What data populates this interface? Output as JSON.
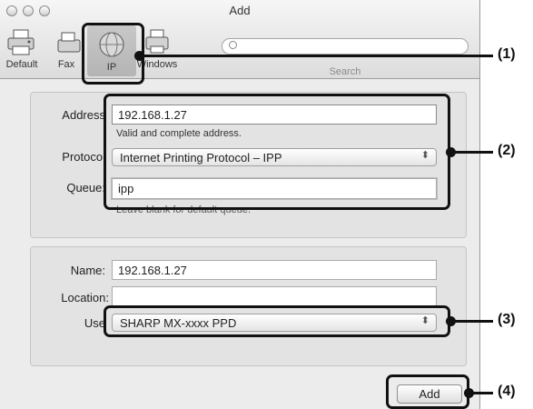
{
  "window": {
    "title": "Add"
  },
  "toolbar": {
    "items": [
      {
        "label": "Default",
        "icon": "printer-icon"
      },
      {
        "label": "Fax",
        "icon": "fax-icon"
      },
      {
        "label": "IP",
        "icon": "globe-icon"
      },
      {
        "label": "Windows",
        "icon": "windows-printer-icon"
      }
    ],
    "search_label": "Search"
  },
  "connection": {
    "address_label": "Address",
    "address_value": "192.168.1.27",
    "address_status": "Valid and complete address.",
    "protocol_label": "Protocol",
    "protocol_value": "Internet Printing Protocol – IPP",
    "queue_label": "Queue:",
    "queue_value": "ipp",
    "queue_hint": "Leave blank for default queue."
  },
  "printer": {
    "name_label": "Name:",
    "name_value": "192.168.1.27",
    "location_label": "Location:",
    "location_value": "",
    "use_label": "Use",
    "use_value": "SHARP MX-xxxx PPD"
  },
  "actions": {
    "add_label": "Add"
  },
  "callouts": [
    "(1)",
    "(2)",
    "(3)",
    "(4)"
  ]
}
